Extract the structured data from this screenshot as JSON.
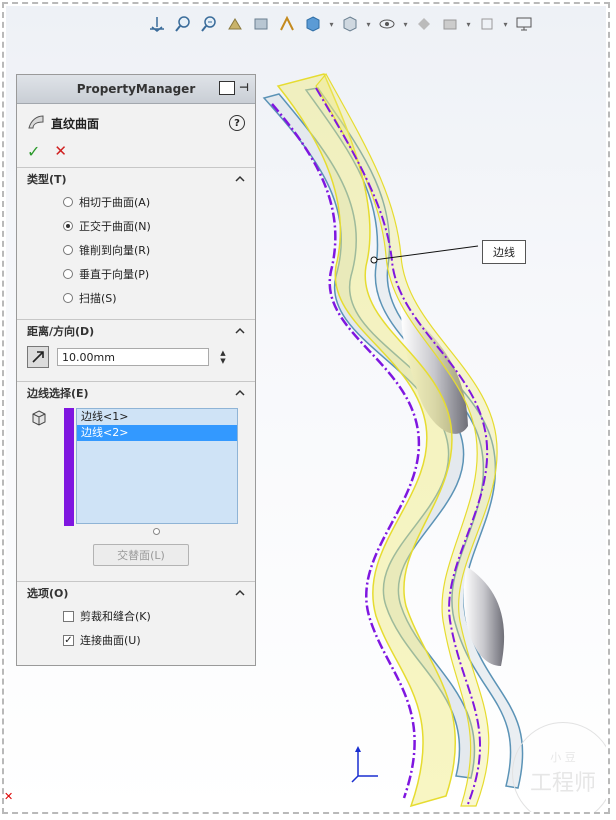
{
  "property_manager": {
    "header_title": "PropertyManager",
    "feature_title": "直纹曲面",
    "help_glyph": "?",
    "ok_glyph": "✓",
    "cancel_glyph": "✕",
    "type_section": {
      "label": "类型(T)",
      "options": [
        {
          "label": "相切于曲面(A)",
          "selected": false
        },
        {
          "label": "正交于曲面(N)",
          "selected": true
        },
        {
          "label": "锥削到向量(R)",
          "selected": false
        },
        {
          "label": "垂直于向量(P)",
          "selected": false
        },
        {
          "label": "扫描(S)",
          "selected": false
        }
      ]
    },
    "distance_section": {
      "label": "距离/方向(D)",
      "value": "10.00mm"
    },
    "edge_section": {
      "label": "边线选择(E)",
      "items": [
        "边线<1>",
        "边线<2>"
      ],
      "selected_index": 1,
      "button_label": "交替面(L)"
    },
    "options_section": {
      "label": "选项(O)",
      "checkboxes": [
        {
          "label": "剪裁和缝合(K)",
          "checked": false
        },
        {
          "label": "连接曲面(U)",
          "checked": true
        }
      ]
    }
  },
  "viewport": {
    "callout_label": "边线",
    "watermark_top": "小 豆",
    "watermark_main": "工程师"
  },
  "colors": {
    "edge_purple": "#7f16e0",
    "surface_yellow": "#f0ec7a",
    "surface_blue": "#5b93b6",
    "selection_blue": "#3399ff"
  },
  "toolbar_icons": [
    "view-orientation-icon",
    "zoom-to-fit-icon",
    "zoom-area-icon",
    "previous-view-icon",
    "section-view-icon",
    "dynamic-annotation-icon",
    "view-cube-icon",
    "display-style-icon",
    "hide-show-icon",
    "edit-appearance-icon",
    "apply-scene-icon",
    "view-settings-icon",
    "monitor-icon"
  ]
}
